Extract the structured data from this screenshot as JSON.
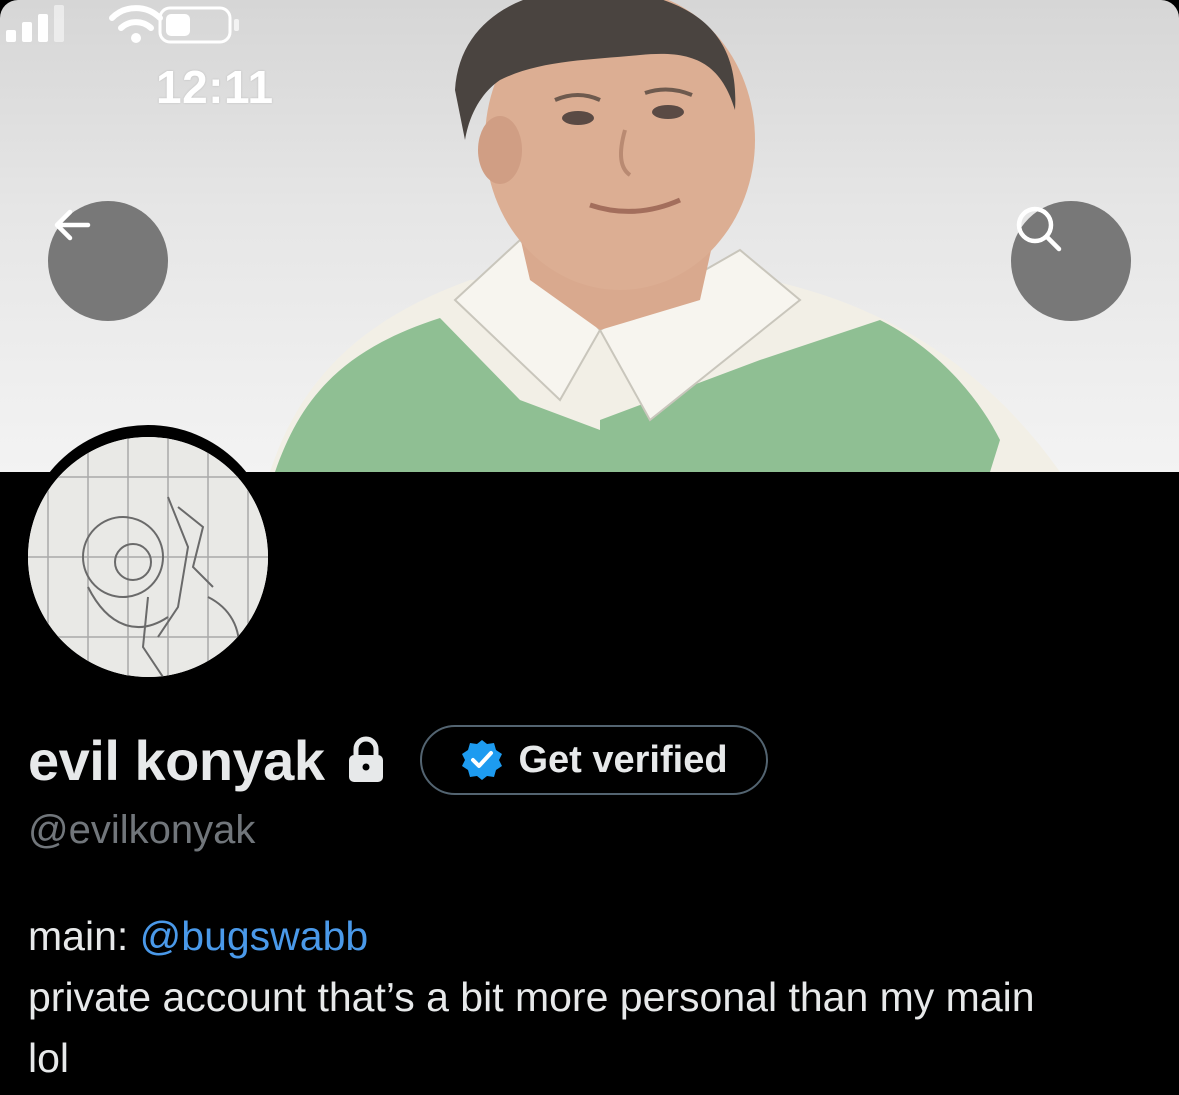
{
  "status_bar": {
    "time": "12:11"
  },
  "header": {
    "back_icon": "arrow-left-icon",
    "search_icon": "search-icon"
  },
  "profile": {
    "display_name": "evil konyak",
    "lock_icon": "lock-icon",
    "verify_button_label": "Get verified",
    "handle": "@evilkonyak",
    "bio": {
      "prefix": "main: ",
      "mention": "@bugswabb",
      "line2": "private account that’s a bit more personal than my main",
      "line3": "lol"
    }
  },
  "colors": {
    "background": "#000000",
    "text_primary": "#e7e9ea",
    "text_secondary": "#71767b",
    "link": "#4a99e9",
    "verified_badge": "#1d9bf0",
    "button_border": "#536471"
  }
}
